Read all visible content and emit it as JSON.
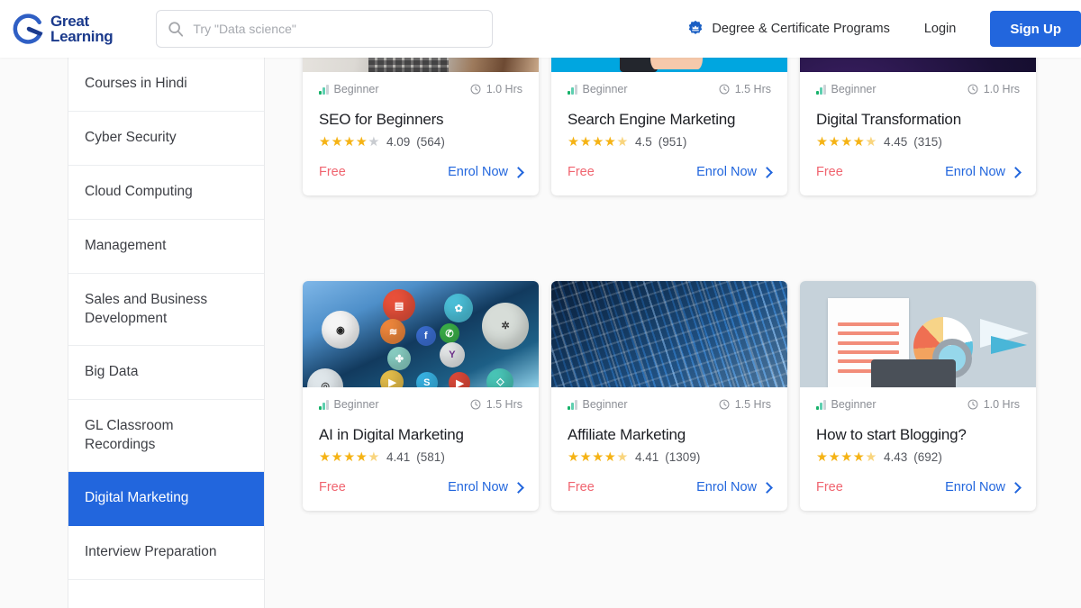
{
  "header": {
    "logo": {
      "line1": "Great",
      "line2": "Learning",
      "icon": "great-learning-g-logo"
    },
    "search": {
      "placeholder": "Try \"Data science\"",
      "value": "",
      "icon": "search-icon"
    },
    "degree_programs": {
      "label": "Degree & Certificate Programs",
      "icon": "badge-icon"
    },
    "login_label": "Login",
    "signup_label": "Sign Up",
    "accent_color": "#2266dd"
  },
  "sidebar": {
    "items": [
      {
        "label": "Courses in Hindi",
        "active": false
      },
      {
        "label": "Cyber Security",
        "active": false
      },
      {
        "label": "Cloud Computing",
        "active": false
      },
      {
        "label": "Management",
        "active": false
      },
      {
        "label": "Sales and Business Development",
        "active": false
      },
      {
        "label": "Big Data",
        "active": false
      },
      {
        "label": "GL Classroom Recordings",
        "active": false
      },
      {
        "label": "Digital Marketing",
        "active": true
      },
      {
        "label": "Interview Preparation",
        "active": false
      }
    ],
    "active_bg": "#2266dd"
  },
  "courses": [
    {
      "level": "Beginner",
      "duration": "1.0 Hrs",
      "title": "SEO for Beginners",
      "rating": "4.09",
      "reviews": "(564)",
      "stars_full": 4,
      "stars_half": 0,
      "price": "Free",
      "cta": "Enrol Now",
      "image": "laptop-keyboard-photo"
    },
    {
      "level": "Beginner",
      "duration": "1.5 Hrs",
      "title": "Search Engine Marketing",
      "rating": "4.5",
      "reviews": "(951)",
      "stars_full": 4,
      "stars_half": 1,
      "price": "Free",
      "cta": "Enrol Now",
      "image": "blue-hand-illustration"
    },
    {
      "level": "Beginner",
      "duration": "1.0 Hrs",
      "title": "Digital Transformation",
      "rating": "4.45",
      "reviews": "(315)",
      "stars_full": 4,
      "stars_half": 1,
      "price": "Free",
      "cta": "Enrol Now",
      "image": "purple-space-tech-graphic"
    },
    {
      "level": "Beginner",
      "duration": "1.5 Hrs",
      "title": "AI in Digital Marketing",
      "rating": "4.41",
      "reviews": "(581)",
      "stars_full": 4,
      "stars_half": 1,
      "price": "Free",
      "cta": "Enrol Now",
      "image": "social-media-app-icons-photo"
    },
    {
      "level": "Beginner",
      "duration": "1.5 Hrs",
      "title": "Affiliate Marketing",
      "rating": "4.41",
      "reviews": "(1309)",
      "stars_full": 4,
      "stars_half": 1,
      "price": "Free",
      "cta": "Enrol Now",
      "image": "blue-app-grid-photo"
    },
    {
      "level": "Beginner",
      "duration": "1.0 Hrs",
      "title": "How to start Blogging?",
      "rating": "4.43",
      "reviews": "(692)",
      "stars_full": 4,
      "stars_half": 1,
      "price": "Free",
      "cta": "Enrol Now",
      "image": "blogging-content-illustration"
    }
  ]
}
